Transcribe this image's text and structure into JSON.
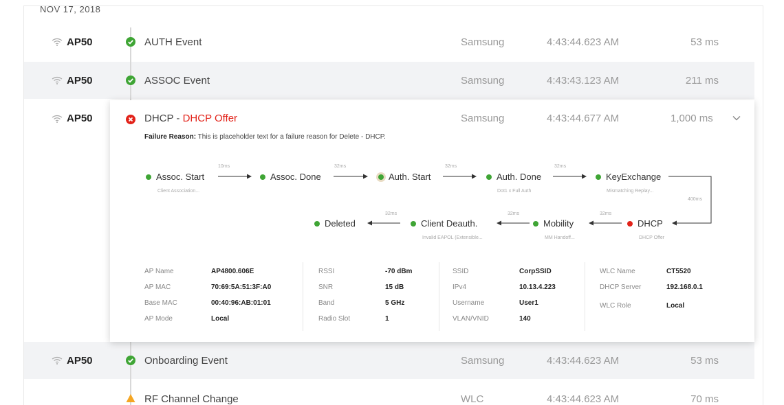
{
  "date_header": "NOV 17, 2018",
  "rows": [
    {
      "ap": "AP50",
      "event": "AUTH Event",
      "device": "Samsung",
      "time": "4:43:44.623 AM",
      "duration": "53 ms",
      "status": "success"
    },
    {
      "ap": "AP50",
      "event": "ASSOC Event",
      "device": "Samsung",
      "time": "4:43:43.123 AM",
      "duration": "211 ms",
      "status": "success"
    },
    {
      "ap": "AP50",
      "event": "Onboarding Event",
      "device": "Samsung",
      "time": "4:43:44.623 AM",
      "duration": "53 ms",
      "status": "success"
    },
    {
      "ap": "",
      "event": "RF Channel Change",
      "device": "WLC",
      "time": "4:43:44.623 AM",
      "duration": "70 ms",
      "status": "warning"
    }
  ],
  "expanded": {
    "ap": "AP50",
    "title_prefix": "DHCP -",
    "title_highlight": "DHCP Offer",
    "device": "Samsung",
    "time": "4:43:44.677 AM",
    "duration": "1,000 ms",
    "status": "error",
    "failure_label": "Failure Reason:",
    "failure_text": "This is placeholder text for a failure reason for Delete - DHCP.",
    "flow": {
      "nodes": [
        {
          "label": "Assoc. Start",
          "sub": "Client Association..."
        },
        {
          "label": "Assoc. Done",
          "sub": ""
        },
        {
          "label": "Auth. Start",
          "sub": ""
        },
        {
          "label": "Auth. Done",
          "sub": "Dot1 x Full Auth"
        },
        {
          "label": "KeyExchange",
          "sub": "Mismatching Replay..."
        },
        {
          "label": "DHCP",
          "sub": "DHCP Offer"
        },
        {
          "label": "Mobility",
          "sub": "MM Handoff..."
        },
        {
          "label": "Client Deauth.",
          "sub": "Invalid EAPOL (Extensible..."
        },
        {
          "label": "Deleted",
          "sub": ""
        }
      ],
      "gaps": [
        "10ms",
        "32ms",
        "32ms",
        "32ms",
        "400ms",
        "32ms",
        "32ms",
        "32ms"
      ]
    },
    "details": {
      "col1": [
        {
          "label": "AP Name",
          "value": "AP4800.606E"
        },
        {
          "label": "AP MAC",
          "value": "70:69:5A:51:3F:A0"
        },
        {
          "label": "Base MAC",
          "value": "00:40:96:AB:01:01"
        },
        {
          "label": "AP Mode",
          "value": "Local"
        }
      ],
      "col2": [
        {
          "label": "RSSI",
          "value": "-70 dBm"
        },
        {
          "label": "SNR",
          "value": "15 dB"
        },
        {
          "label": "Band",
          "value": "5 GHz"
        },
        {
          "label": "Radio Slot",
          "value": "1"
        }
      ],
      "col3": [
        {
          "label": "SSID",
          "value": "CorpSSID"
        },
        {
          "label": "IPv4",
          "value": "10.13.4.223"
        },
        {
          "label": "Username",
          "value": "User1"
        },
        {
          "label": "VLAN/VNID",
          "value": "140"
        }
      ],
      "col4": [
        {
          "label": "WLC Name",
          "value": "CT5520"
        },
        {
          "label": "DHCP Server",
          "value": "192.168.0.1"
        },
        {
          "label": "WLC Role",
          "value": "Local"
        }
      ]
    }
  },
  "colors": {
    "success": "#3fa535",
    "error": "#e2231a",
    "warning": "#f5a623",
    "muted": "#999999"
  },
  "icons": {
    "ap": "wifi-icon",
    "success": "check-circle-icon",
    "error": "x-circle-icon",
    "warning": "warning-triangle-icon",
    "expand": "chevron-down-icon"
  }
}
